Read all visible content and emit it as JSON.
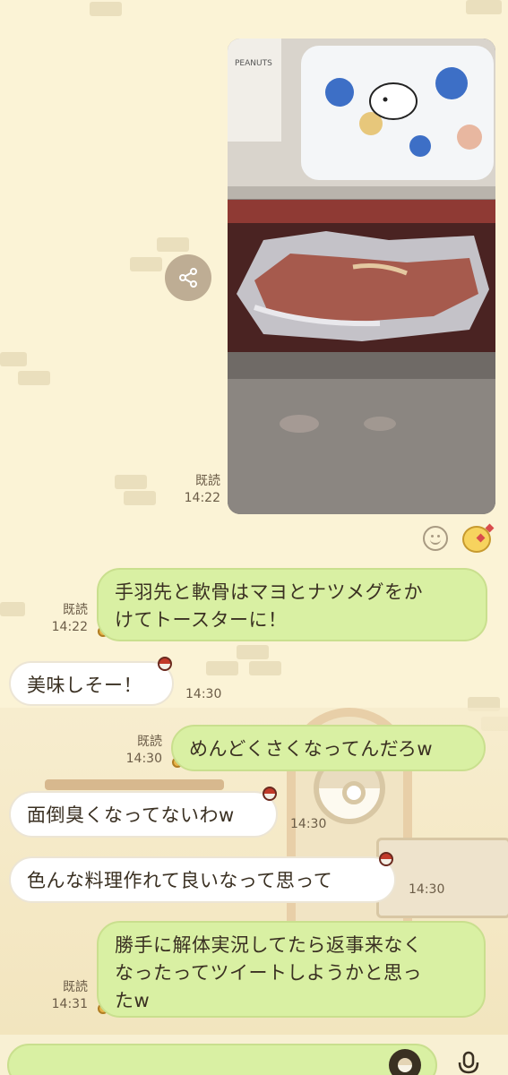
{
  "photo_message": {
    "read_label": "既読",
    "time": "14:22",
    "photo_text": "PEANUTS"
  },
  "messages": [
    {
      "side": "me",
      "text_lines": [
        "手羽先と軟骨はマヨとナツメグをか",
        "けてトースターに！"
      ],
      "read_label": "既読",
      "time": "14:22"
    },
    {
      "side": "other",
      "text": "美味しそー！",
      "time": "14:30"
    },
    {
      "side": "me",
      "text": "めんどくさくなってんだろw",
      "read_label": "既読",
      "time": "14:30"
    },
    {
      "side": "other",
      "text": "面倒臭くなってないわw",
      "time": "14:30"
    },
    {
      "side": "other",
      "text": "色んな料理作れて良いなって思って",
      "time": "14:30"
    },
    {
      "side": "me",
      "text_lines": [
        "勝手に解体実況してたら返事来なく",
        "なったってツイートしようかと思っ",
        "たw"
      ],
      "read_label": "既読",
      "time": "14:31"
    }
  ],
  "icons": {
    "share": "share-icon",
    "reaction": "smiley-icon",
    "sticker": "pikachu-sticker-icon",
    "pokeball": "pokeball-icon",
    "mic": "microphone-icon"
  },
  "colors": {
    "background": "#fbf3d6",
    "my_bubble": "#d9f0a3",
    "other_bubble": "#ffffff"
  }
}
